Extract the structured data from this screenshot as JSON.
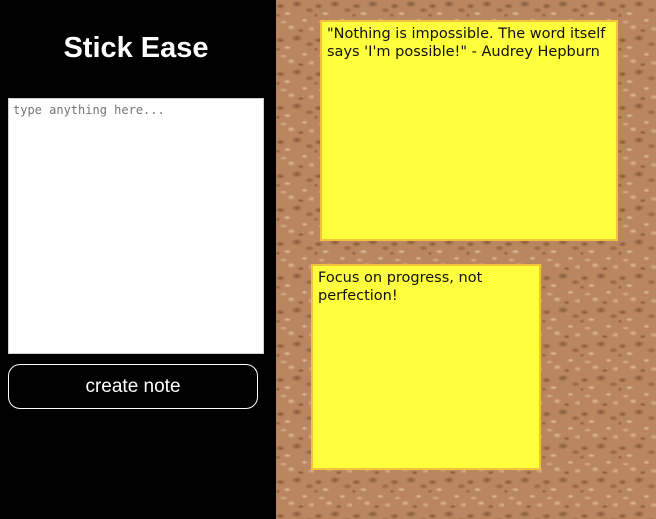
{
  "app": {
    "title": "Stick Ease"
  },
  "composer": {
    "placeholder": "type anything here...",
    "value": "",
    "create_label": "create note"
  },
  "notes": [
    {
      "text": "\"Nothing is impossible. The word itself says 'I'm possible!\" - Audrey Hepburn"
    },
    {
      "text": "Focus on progress, not perfection!"
    }
  ],
  "colors": {
    "sidebar_bg": "#000000",
    "note_bg": "#ffff3e",
    "note_border": "#f1c23a",
    "board_base": "#b98660"
  }
}
